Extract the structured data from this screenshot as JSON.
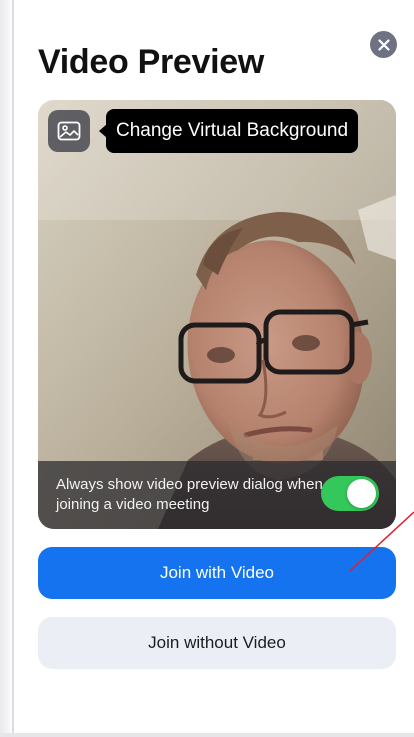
{
  "dialog": {
    "title": "Video Preview",
    "close_icon": "close-icon"
  },
  "preview": {
    "background_button_icon": "image-icon",
    "tooltip": "Change Virtual Background",
    "always_show_text": "Always show video preview dialog when joining a video meeting",
    "always_show_toggle_on": true
  },
  "actions": {
    "join_with_video": "Join with Video",
    "join_without_video": "Join without Video"
  },
  "colors": {
    "primary": "#1573f0",
    "toggle_on": "#34c759",
    "secondary_bg": "#eceef6",
    "annotation": "#e0202a"
  }
}
